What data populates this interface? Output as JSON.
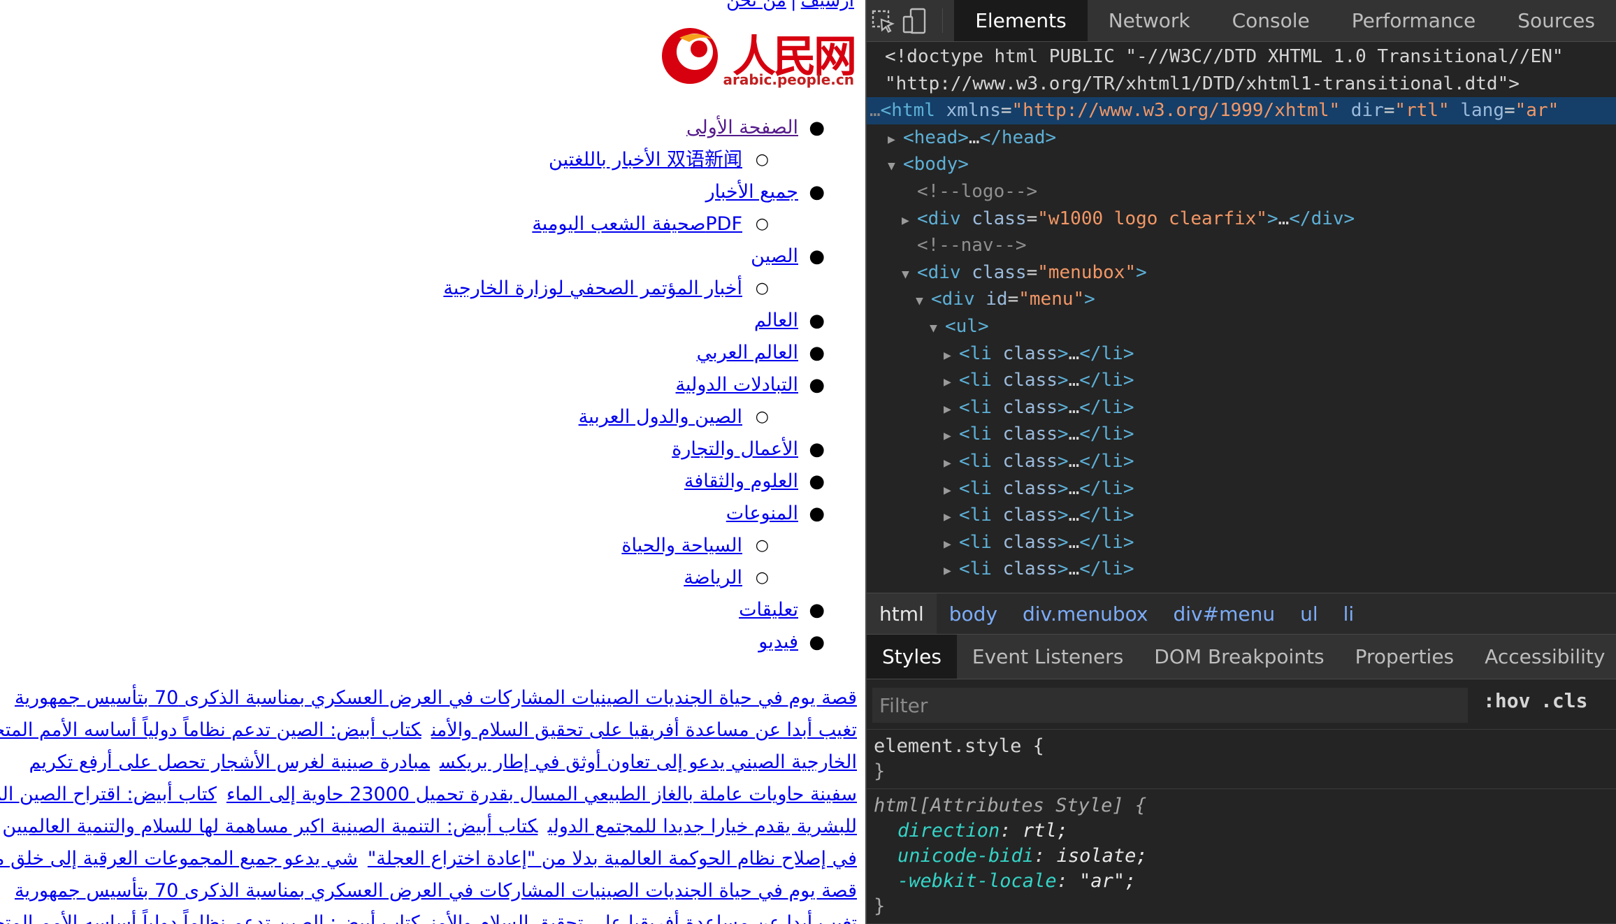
{
  "page": {
    "top_links": [
      "أرشيف",
      "من نحن"
    ],
    "top_links_separator": "|",
    "logo": {
      "chinese": "人民网",
      "domain": "arabic.people.cn"
    },
    "menu": [
      {
        "label": "الصفحة الأولى",
        "level": 1,
        "visited": true
      },
      {
        "label": "双语新闻 الأخبار باللغتين",
        "level": 2
      },
      {
        "label": "جميع الأخبار",
        "level": 1
      },
      {
        "label": "PDFصحيفة الشعب اليومية",
        "level": 2
      },
      {
        "label": "الصين",
        "level": 1
      },
      {
        "label": "أخبار المؤتمر الصحفي لوزارة الخارجية",
        "level": 2
      },
      {
        "label": "العالم",
        "level": 1
      },
      {
        "label": "العالم العربي",
        "level": 1
      },
      {
        "label": "التبادلات الدولية",
        "level": 1
      },
      {
        "label": "الصين والدول العربية",
        "level": 2
      },
      {
        "label": "الأعمال والتجارة",
        "level": 1
      },
      {
        "label": "العلوم والثقافة",
        "level": 1
      },
      {
        "label": "المنوعات",
        "level": 1
      },
      {
        "label": "السياحة والحياة",
        "level": 2
      },
      {
        "label": "الرياضة",
        "level": 2
      },
      {
        "label": "تعليقات",
        "level": 1
      },
      {
        "label": "فيديو",
        "level": 1
      }
    ],
    "headlines": [
      [
        "قصة يوم في حياة الجنديات الصينيات المشاركات في العرض العسكري بمناسبة الذكرى 70 بتأسيس جمهورية"
      ],
      [
        "تغيب أبدا عن مساعدة أفريقيا على تحقيق السلام والأمن",
        "كتاب أبيض: الصين تدعم نظاماً دولياً أساسه الأمم المتحدة"
      ],
      [
        "الخارجية الصيني يدعو إلى تعاون أوثق في إطار بريكس",
        "مبادرة صينية لغرس الأشجار تحصل على أرفع تكريم"
      ],
      [
        "سفينة حاويات عاملة بالغاز الطبيعي المسال بقدرة تحميل 23000 حاوية إلى الماء",
        "كتاب أبيض: اقتراح الصين المجتمع"
      ],
      [
        "للبشرية يقدم خيارا جديدا للمجتمع الدولي",
        "كتاب أبيض: التنمية الصينية اكبر مساهمة لها للسلام والتنمية العالميين"
      ],
      [
        "في إصلاح نظام الحوكمة العالمية بدلا من \"إعادة اختراع العجلة\"",
        "شي يدعو جميع المجموعات العرقية إلى خلق مستقبل"
      ],
      [
        "قصة يوم في حياة الجنديات الصينيات المشاركات في العرض العسكري بمناسبة الذكرى 70 بتأسيس جمهورية"
      ],
      [
        "تغيب أبدا عن مساعدة أفريقيا على تحقيق السلام والأمن",
        "كتاب أبيض: الصين تدعم نظاماً دولياً أساسه الأمم المتحدة"
      ]
    ]
  },
  "devtools": {
    "icons": {
      "inspect": "inspect-element-icon",
      "device": "device-toolbar-icon"
    },
    "tabs": [
      "Elements",
      "Network",
      "Console",
      "Performance",
      "Sources"
    ],
    "active_tab": "Elements",
    "dom": {
      "doctype_1": "<!doctype html PUBLIC \"-//W3C//DTD XHTML 1.0 Transitional//EN\"",
      "doctype_2": "\"http://www.w3.org/TR/xhtml1/DTD/xhtml1-transitional.dtd\">",
      "html_tag": "<html",
      "html_xmlns_attr": "xmlns",
      "html_xmlns_val": "\"http://www.w3.org/1999/xhtml\"",
      "html_dir_attr": "dir",
      "html_dir_val": "\"rtl\"",
      "html_lang_attr": "lang",
      "html_lang_val": "\"ar\"",
      "head": "<head>",
      "head_ellipsis": "…",
      "head_close": "</head>",
      "body": "<body>",
      "comment_logo": "<!--logo-->",
      "div_open": "<div",
      "class_attr": "class",
      "logo_class_val": "\"w1000 logo clearfix\"",
      "div_close_ellipsis": "…",
      "div_close": "</div>",
      "comment_nav": "<!--nav-->",
      "menubox_class_val": "\"menubox\"",
      "id_attr": "id",
      "menu_id_val": "\"menu\"",
      "ul": "<ul>",
      "li_open": "<li",
      "li_close": "</li>",
      "li_count": 9
    },
    "breadcrumbs": [
      "html",
      "body",
      "div.menubox",
      "div#menu",
      "ul",
      "li"
    ],
    "sub_tabs": [
      "Styles",
      "Event Listeners",
      "DOM Breakpoints",
      "Properties",
      "Accessibility"
    ],
    "active_sub_tab": "Styles",
    "filter": {
      "placeholder": "Filter",
      "hov": ":hov",
      "cls": ".cls"
    },
    "styles": {
      "element_selector": "element.style {",
      "close_brace": "}",
      "attr_selector": "html[Attributes Style] {",
      "props": [
        {
          "name": "direction",
          "value": "rtl;"
        },
        {
          "name": "unicode-bidi",
          "value": "isolate;"
        },
        {
          "name": "-webkit-locale",
          "value": "\"ar\";"
        }
      ]
    }
  }
}
